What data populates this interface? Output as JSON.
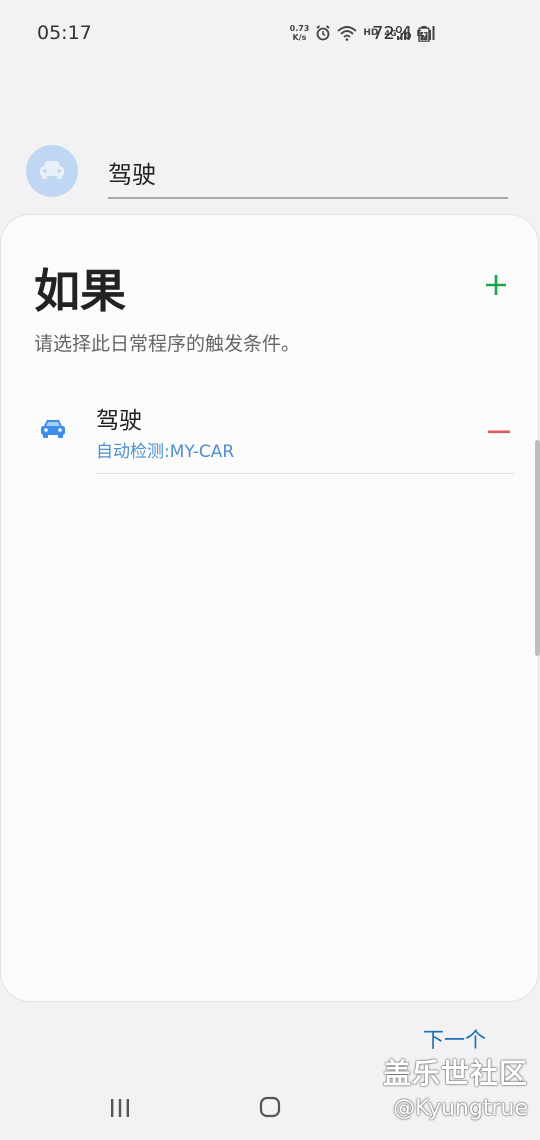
{
  "status_bar": {
    "time": "05:17",
    "net_speed_value": "0.73",
    "net_speed_unit": "K/s",
    "icons": [
      "alarm-icon",
      "wifi-icon",
      "hd-label",
      "signal-4g-icon",
      "signal-e-icon",
      "battery-charging-icon"
    ],
    "hd": "HD",
    "net_4g": "4G",
    "net_e": "E",
    "battery_percent": "72%"
  },
  "routine": {
    "name": "驾驶",
    "avatar_icon": "car-icon",
    "avatar_color": "#bfd7f2"
  },
  "if_section": {
    "title": "如果",
    "subtitle": "请选择此日常程序的触发条件。",
    "add_icon": "plus-icon",
    "add_color": "#1fa34a",
    "conditions": [
      {
        "name": "驾驶",
        "detail": "自动检测:MY-CAR",
        "icon": "car-icon",
        "remove_icon": "minus-icon",
        "remove_color": "#e05a5a"
      }
    ]
  },
  "next_button": {
    "label": "下一个"
  },
  "watermark": {
    "line1": "盖乐世社区",
    "line2": "@Kyungtrue"
  },
  "nav_bar": {
    "recent_icon": "recent-apps-icon",
    "home_icon": "home-icon"
  },
  "colors": {
    "accent_blue": "#1e6eb0",
    "detail_blue": "#4e8fcc"
  }
}
